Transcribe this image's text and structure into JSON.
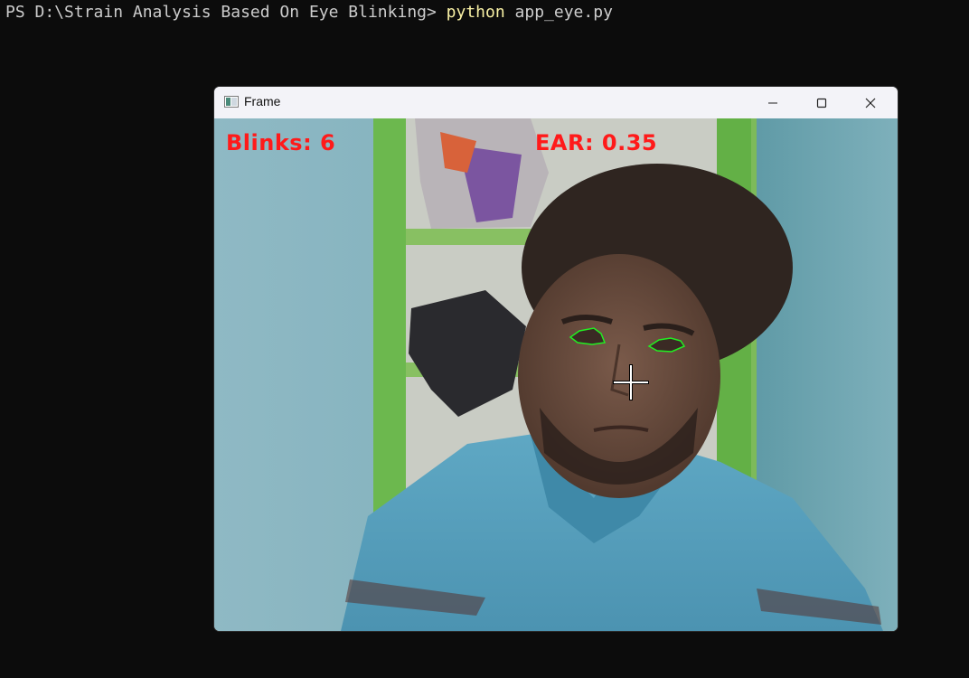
{
  "terminal": {
    "prompt": "PS D:\\Strain Analysis Based On Eye Blinking> ",
    "command": "python",
    "argument": " app_eye.py"
  },
  "window": {
    "title": "Frame",
    "controls": {
      "minimize_icon": "minimize-icon",
      "maximize_icon": "maximize-icon",
      "close_icon": "close-icon"
    }
  },
  "frame_overlay": {
    "blinks_text": "Blinks: 6",
    "ear_text": "EAR: 0.35",
    "blink_count": 6,
    "ear_value": 0.35,
    "overlay_color": "#ff1a1a",
    "eye_contour_color": "#22ee22"
  },
  "colors": {
    "terminal_bg": "#0c0c0c",
    "terminal_text": "#cccccc",
    "command_highlight": "#f9f1a5"
  }
}
